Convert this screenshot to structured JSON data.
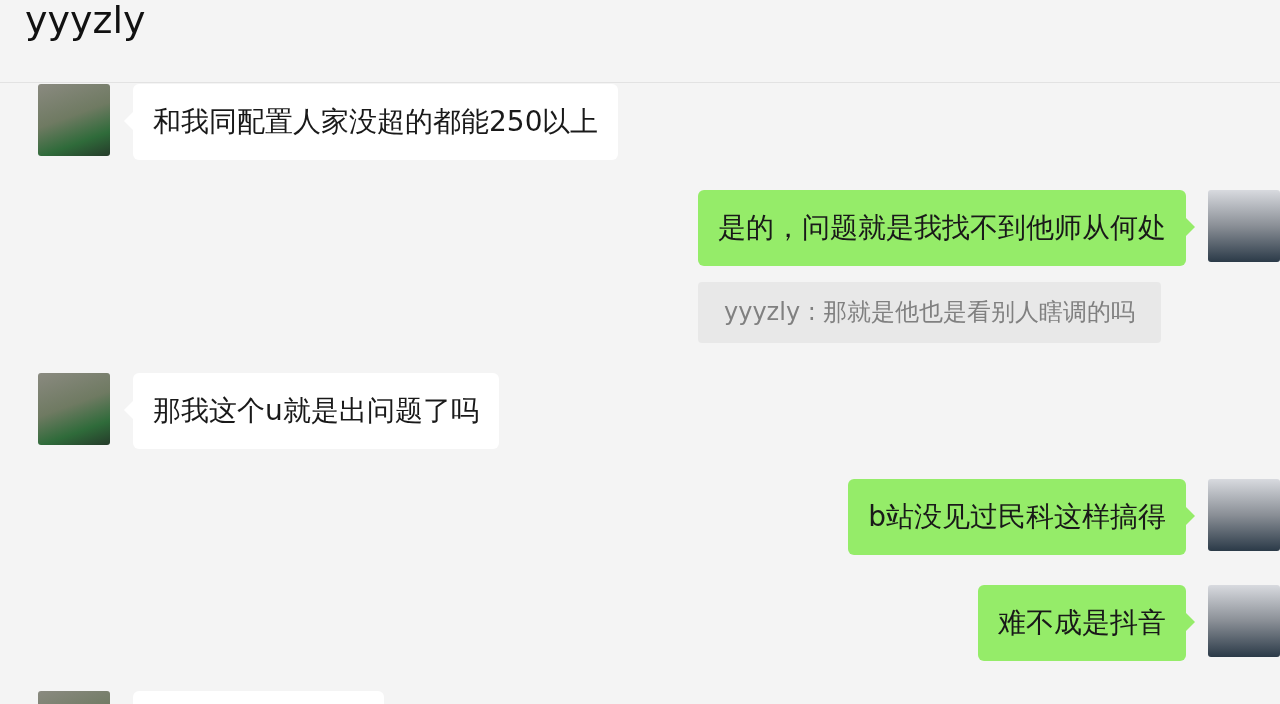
{
  "header": {
    "title": "yyyzly"
  },
  "messages": [
    {
      "kind": "incoming",
      "text": "和我同配置人家没超的都能250以上"
    },
    {
      "kind": "outgoing",
      "text": "是的，问题就是我找不到他师从何处",
      "quote": "yyyzly : 那就是他也是看别人瞎调的吗"
    },
    {
      "kind": "incoming",
      "text": "那我这个u就是出问题了吗"
    },
    {
      "kind": "outgoing",
      "text": "b站没见过民科这样搞得"
    },
    {
      "kind": "outgoing",
      "text": "难不成是抖音"
    },
    {
      "kind": "incoming"
    }
  ]
}
